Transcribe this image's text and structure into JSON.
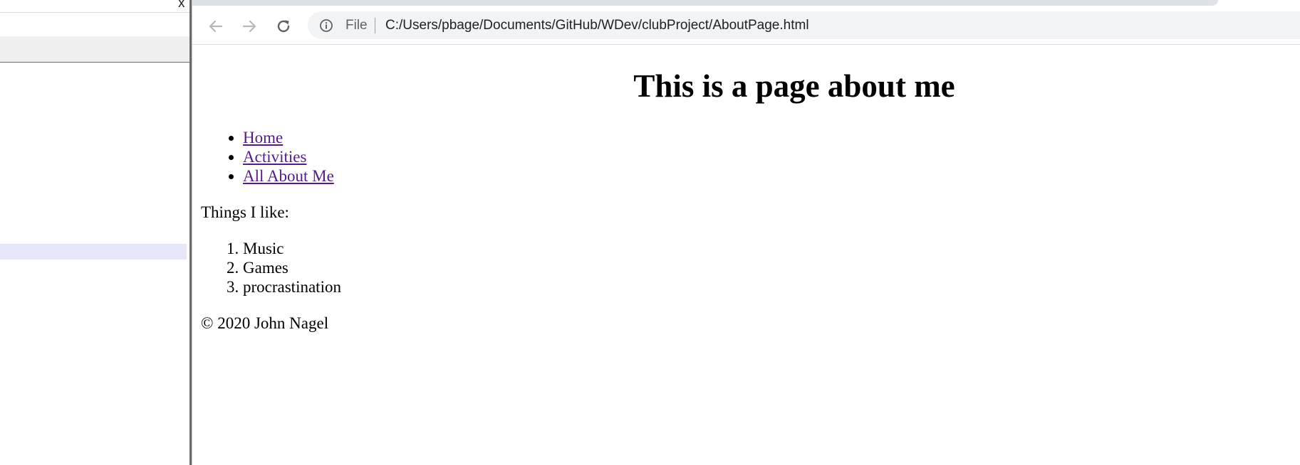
{
  "left_panel": {
    "close_label": "x"
  },
  "toolbar": {
    "back_icon": "arrow-left-icon",
    "forward_icon": "arrow-right-icon",
    "reload_icon": "reload-icon",
    "info_icon": "info-icon",
    "scheme": "File",
    "url": "C:/Users/pbage/Documents/GitHub/WDev/clubProject/AboutPage.html"
  },
  "page": {
    "title": "This is a page about me",
    "nav_links": [
      {
        "label": "Home"
      },
      {
        "label": "Activities"
      },
      {
        "label": "All About Me"
      }
    ],
    "likes_label": "Things I like:",
    "likes": [
      "Music",
      "Games",
      "procrastination"
    ],
    "footer": "© 2020 John Nagel"
  },
  "colors": {
    "visited_link": "#551a8b",
    "omnibox_bg": "#f1f3f4",
    "selection_highlight": "#e5e6fb"
  }
}
